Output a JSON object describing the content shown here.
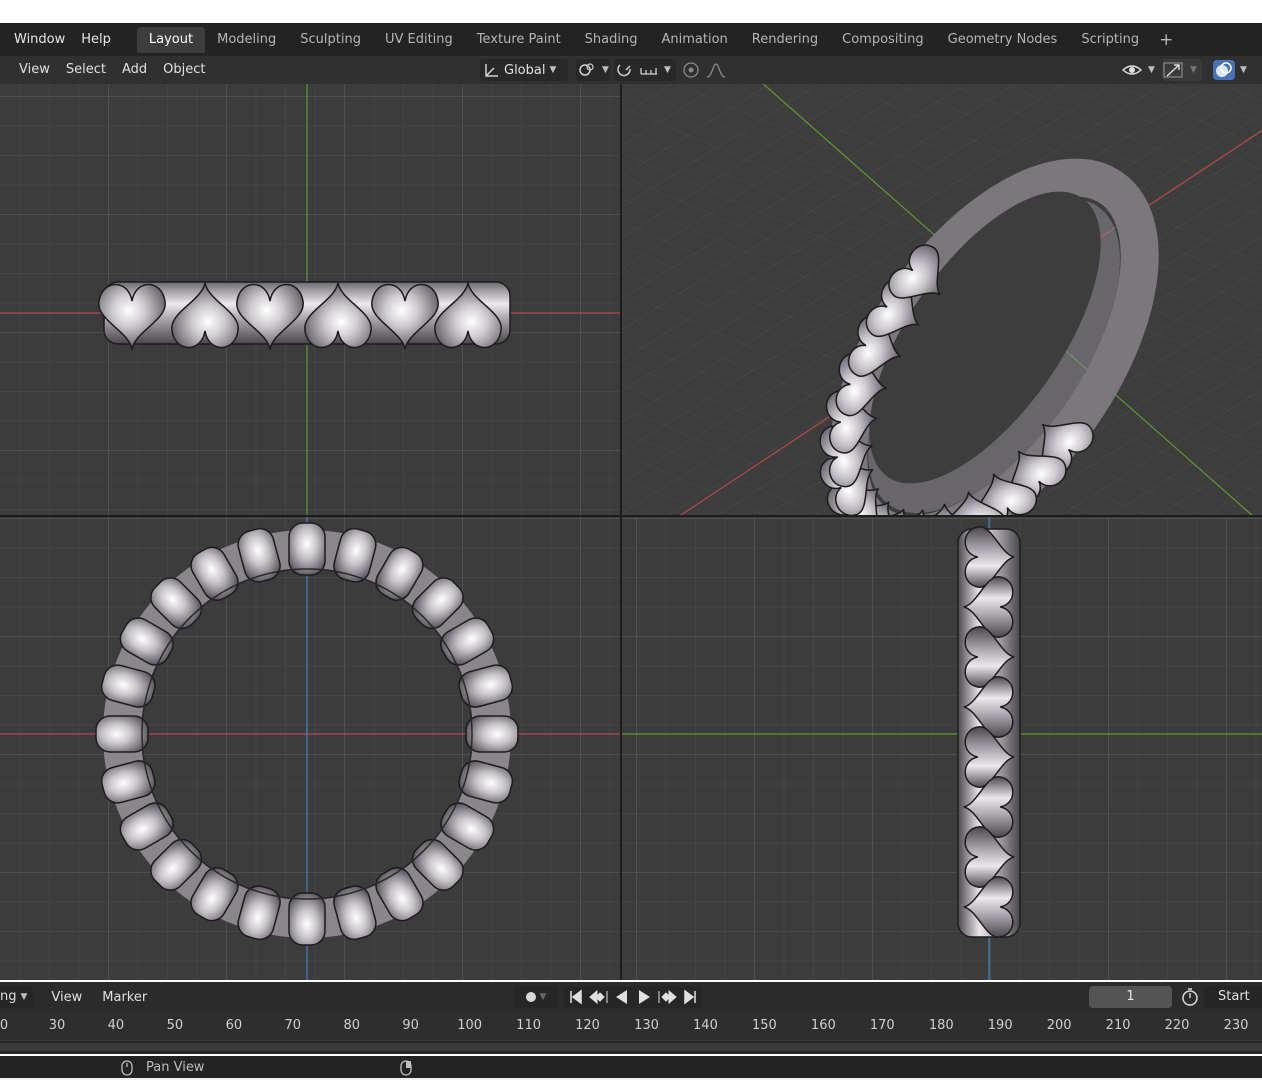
{
  "menubar": {
    "items": [
      "Window",
      "Help"
    ],
    "workspaces": [
      "Layout",
      "Modeling",
      "Sculpting",
      "UV Editing",
      "Texture Paint",
      "Shading",
      "Animation",
      "Rendering",
      "Compositing",
      "Geometry Nodes",
      "Scripting"
    ],
    "active_workspace": "Layout",
    "add_label": "+"
  },
  "viewport_header": {
    "menus": [
      "View",
      "Select",
      "Add",
      "Object"
    ],
    "transform_orientation": "Global"
  },
  "timeline": {
    "dropdown_fragment": "ng",
    "menus": [
      "View",
      "Marker"
    ],
    "current_frame": "1",
    "start_label": "Start",
    "ticks": [
      "0",
      "30",
      "40",
      "50",
      "60",
      "70",
      "80",
      "90",
      "100",
      "110",
      "120",
      "130",
      "140",
      "150",
      "160",
      "170",
      "180",
      "190",
      "200",
      "210",
      "220",
      "230"
    ]
  },
  "statusbar": {
    "hint": "Pan View"
  },
  "colors": {
    "axis_x": "#c44a4a",
    "axis_y": "#6fa832",
    "axis_z": "#4a7fc4",
    "ring_metal": "#b9b6bb",
    "active_tab_bg": "#3d3d3d"
  },
  "icons": [
    "transform-orientation-icon",
    "pivot-icon",
    "snap-icon",
    "snap-increment-icon",
    "proportional-edit-icon",
    "falloff-icon",
    "visibility-icon",
    "gizmo-icon",
    "overlay-icon",
    "record-icon",
    "jump-start-icon",
    "prev-keyframe-icon",
    "play-reverse-icon",
    "play-icon",
    "next-keyframe-icon",
    "jump-end-icon",
    "stopwatch-icon",
    "mouse-icon"
  ]
}
